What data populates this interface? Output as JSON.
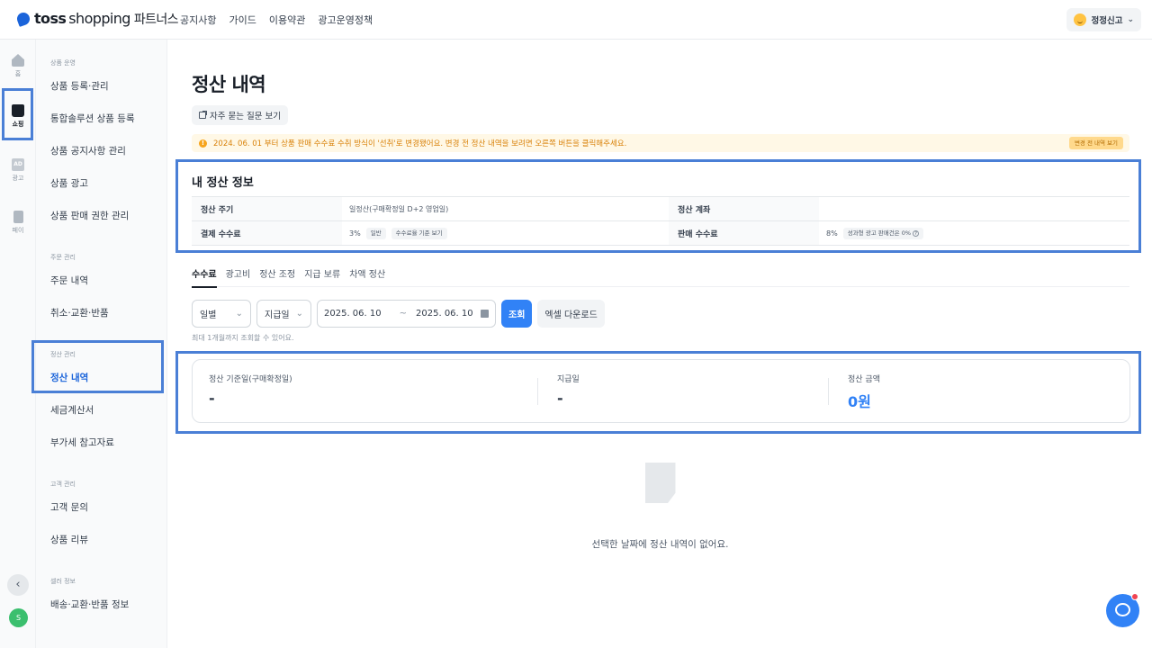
{
  "header": {
    "logo_main": "toss",
    "logo_sub": "shopping",
    "logo_suffix": "파트너스",
    "nav": [
      "공지사항",
      "가이드",
      "이용약관",
      "광고운영정책"
    ],
    "store_name": "정정신고"
  },
  "rail": {
    "items": [
      {
        "label": "홈",
        "icon": "home-icon"
      },
      {
        "label": "쇼핑",
        "icon": "shopping-bag-icon"
      },
      {
        "label": "광고",
        "icon": "ad-icon"
      },
      {
        "label": "페이",
        "icon": "pay-icon"
      }
    ],
    "avatar_initial": "S"
  },
  "sidemenu": {
    "groups": [
      {
        "title": "상품 운영",
        "items": [
          "상품 등록·관리",
          "통합솔루션 상품 등록",
          "상품 공지사항 관리",
          "상품 광고",
          "상품 판매 권한 관리"
        ]
      },
      {
        "title": "주문 관리",
        "items": [
          "주문 내역",
          "취소·교환·반품"
        ]
      },
      {
        "title": "정산 관리",
        "items": [
          "정산 내역",
          "세금계산서",
          "부가세 참고자료"
        ]
      },
      {
        "title": "고객 관리",
        "items": [
          "고객 문의",
          "상품 리뷰"
        ]
      },
      {
        "title": "셀러 정보",
        "items": [
          "배송·교환·반품 정보"
        ]
      }
    ]
  },
  "page": {
    "title": "정산 내역",
    "faq_label": "자주 묻는 질문 보기",
    "notice_text": "2024. 06. 01 부터 상품 판매 수수료 수취 방식이 '선취'로 변경됐어요. 변경 전 정산 내역을 보려면 오른쪽 버튼을 클릭해주세요.",
    "notice_button": "변경 전 내역 보기",
    "info": {
      "title": "내 정산 정보",
      "cycle_label": "정산 주기",
      "cycle_value": "일정산(구매확정일 D+2 영업일)",
      "account_label": "정산 계좌",
      "account_value": "",
      "payment_fee_label": "결제 수수료",
      "payment_fee_value": "3%",
      "payment_fee_chip": "일반",
      "payment_fee_link": "수수료율 기준 보기",
      "sales_fee_label": "판매 수수료",
      "sales_fee_value": "8%",
      "sales_fee_chip": "성과형 광고 판매건은 0%"
    },
    "tabs": [
      "수수료",
      "광고비",
      "정산 조정",
      "지급 보류",
      "차액 정산"
    ],
    "filters": {
      "period": "일별",
      "date_type": "지급일",
      "start_date": "2025. 06. 10",
      "tilde": "~",
      "end_date": "2025. 06. 10",
      "search_label": "조회",
      "excel_label": "엑셀 다운로드",
      "helper": "최대 1개월까지 조회할 수 있어요."
    },
    "summary": {
      "col1_label": "정산 기준일(구매확정일)",
      "col1_value": "-",
      "col2_label": "지급일",
      "col2_value": "-",
      "col3_label": "정산 금액",
      "col3_value": "0원"
    },
    "empty_text": "선택한 날짜에 정산 내역이 없어요."
  },
  "colors": {
    "accent": "#3182f6",
    "highlight": "#4a7fd6",
    "notice_bg": "#fff8e6",
    "notice_text": "#d9820a"
  }
}
